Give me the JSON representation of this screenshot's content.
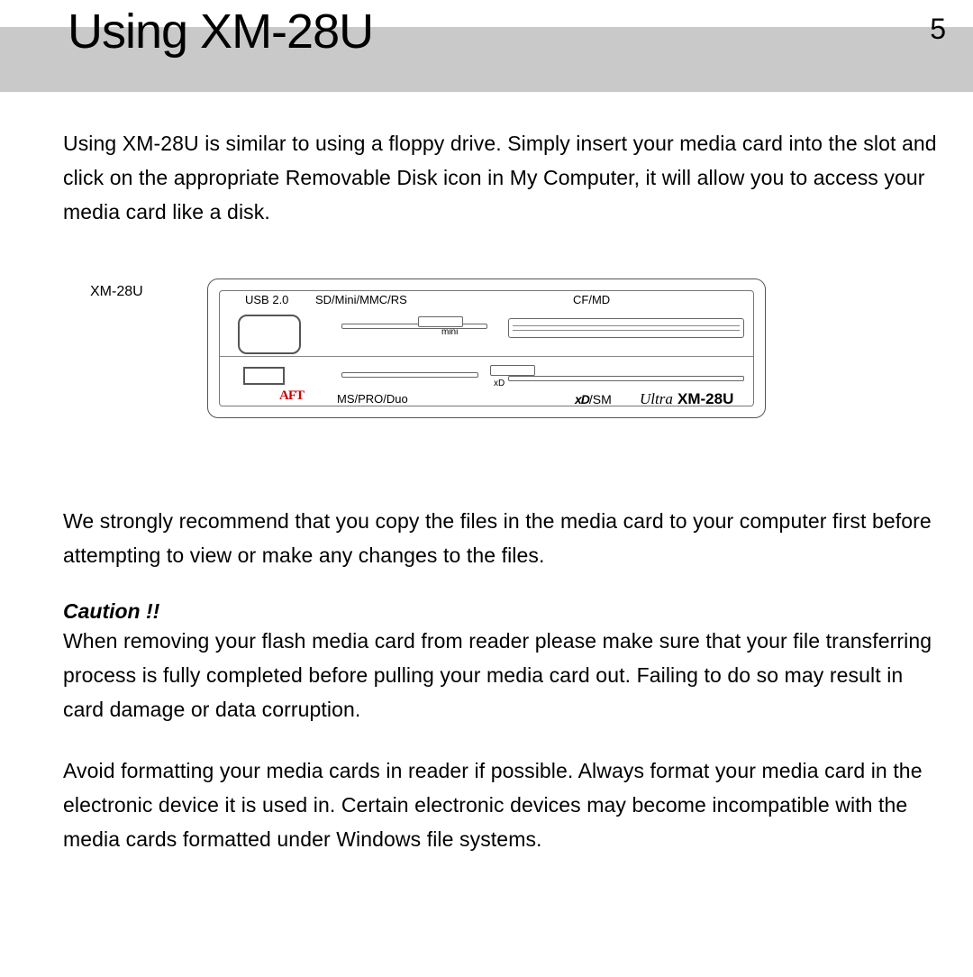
{
  "header": {
    "title": "Using XM-28U",
    "page_number": "5"
  },
  "intro": "Using XM-28U is similar to using a floppy drive. Simply insert your media card into the slot and click on the appropriate Removable Disk icon in My Computer, it will allow you to access your media card like a disk.",
  "device": {
    "side_label": "XM-28U",
    "labels": {
      "usb": "USB 2.0",
      "sd": "SD/Mini/MMC/RS",
      "cf": "CF/MD",
      "mini": "mini",
      "xd": "xD",
      "ms": "MS/PRO/Duo",
      "xdsm_prefix": "xD",
      "xdsm_suffix": "/SM",
      "brand": "AFT",
      "ultra": "Ultra",
      "model": "XM-28U"
    }
  },
  "recommend": "We strongly recommend that you copy the files in the media card to your computer first before attempting to view or make any changes to the files.",
  "caution_heading": "Caution !!",
  "caution_body": "When removing your flash media card from reader please make sure that your file transferring process is fully completed before pulling your media card out. Failing to do so may result in card damage or data corruption.",
  "format_advice": "Avoid formatting your media cards in reader if possible. Always format your media card in the electronic device it is used in. Certain electronic devices may become incompatible with the media cards formatted under Windows file systems."
}
